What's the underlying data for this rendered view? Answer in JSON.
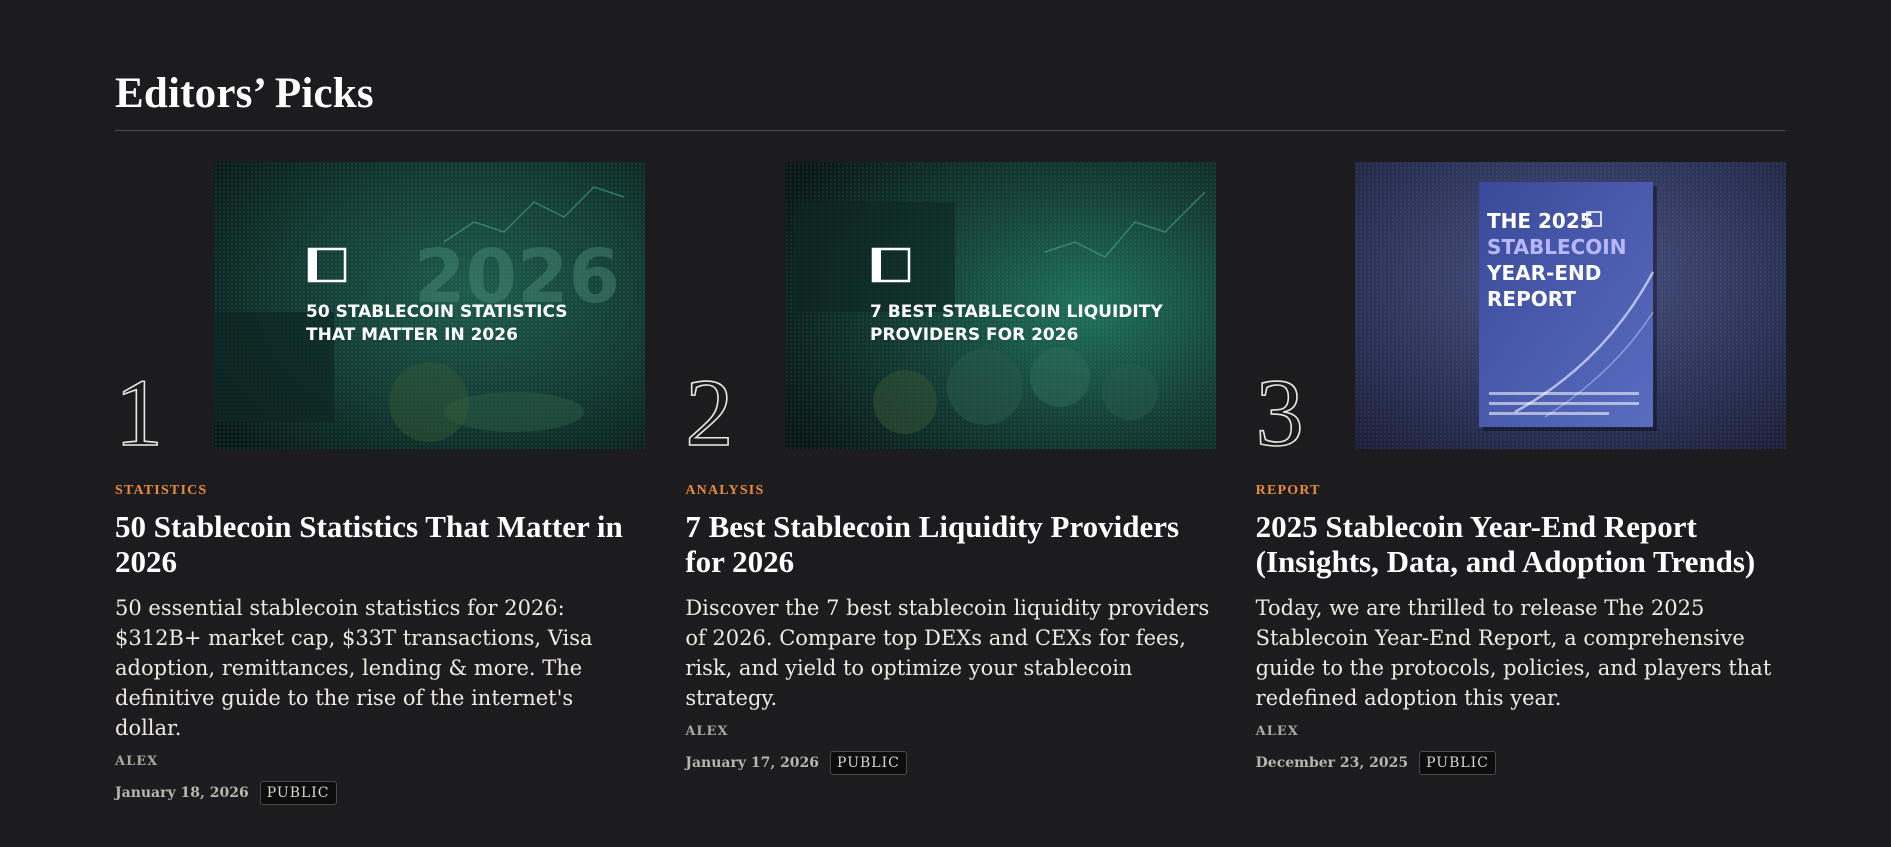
{
  "section": {
    "title": "Editors’ Picks"
  },
  "cards": [
    {
      "rank": "1",
      "thumb_lines": [
        "50 STABLECOIN STATISTICS",
        "THAT MATTER IN 2026"
      ],
      "thumb_watermark": "2026",
      "tag": "STATISTICS",
      "title": "50 Stablecoin Statistics That Matter in 2026",
      "excerpt": "50 essential stablecoin statistics for 2026: $312B+ market cap, $33T transactions, Visa adoption, remittances, lending & more. The definitive guide to the rise of the internet's dollar.",
      "author": "ALEX",
      "date": "January 18, 2026",
      "badge": "PUBLIC"
    },
    {
      "rank": "2",
      "thumb_lines": [
        "7 BEST STABLECOIN LIQUIDITY",
        "PROVIDERS FOR 2026"
      ],
      "tag": "ANALYSIS",
      "title": "7 Best Stablecoin Liquidity Providers for 2026",
      "excerpt": "Discover the 7 best stablecoin liquidity providers of 2026. Compare top DEXs and CEXs for fees, risk, and yield to optimize your stablecoin strategy.",
      "author": "ALEX",
      "date": "January 17, 2026",
      "badge": "PUBLIC"
    },
    {
      "rank": "3",
      "thumb_lines": [
        "THE 2025",
        "STABLECOIN",
        "YEAR-END",
        "REPORT"
      ],
      "tag": "REPORT",
      "title": "2025 Stablecoin Year-End Report (Insights, Data, and Adoption Trends)",
      "excerpt": "Today, we are thrilled to release The 2025 Stablecoin Year-End Report, a comprehensive guide to the protocols, policies, and players that redefined adoption this year.",
      "author": "ALEX",
      "date": "December 23, 2025",
      "badge": "PUBLIC"
    }
  ],
  "colors": {
    "background": "#1c1c1e",
    "tag": "#e88a3c",
    "rule": "#4a4a4d"
  }
}
